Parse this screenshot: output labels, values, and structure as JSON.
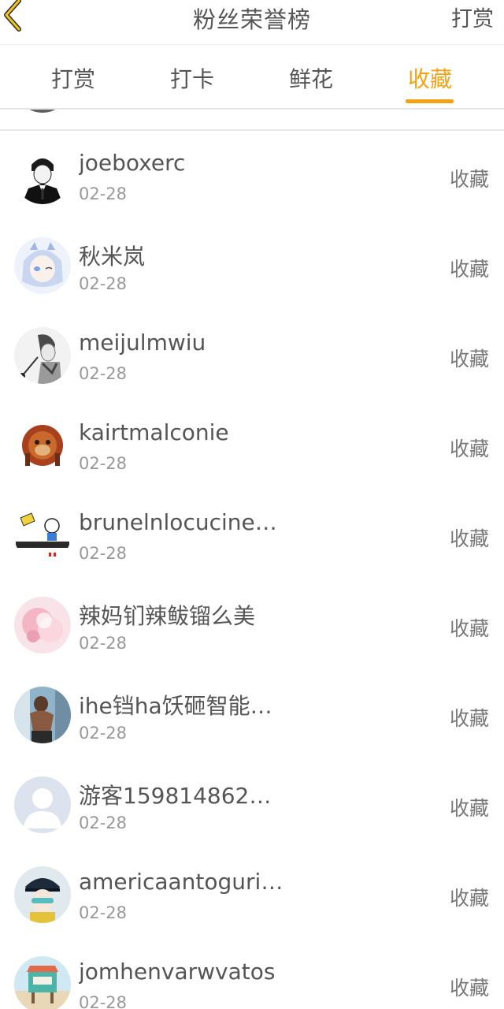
{
  "header": {
    "title": "粉丝荣誉榜",
    "right_label": "打赏"
  },
  "tabs": [
    {
      "label": "打赏",
      "active": false
    },
    {
      "label": "打卡",
      "active": false
    },
    {
      "label": "鲜花",
      "active": false
    },
    {
      "label": "收藏",
      "active": true
    }
  ],
  "colors": {
    "accent": "#f5a316",
    "text": "#555555",
    "subtext": "#999999"
  },
  "list": {
    "items": [
      {
        "name": "joeboxerc",
        "date": "02-28",
        "action": "收藏"
      },
      {
        "name": "秋米岚",
        "date": "02-28",
        "action": "收藏"
      },
      {
        "name": "meijulmwiu",
        "date": "02-28",
        "action": "收藏"
      },
      {
        "name": "kairtmalconie",
        "date": "02-28",
        "action": "收藏"
      },
      {
        "name": "brunelnlocucine…",
        "date": "02-28",
        "action": "收藏"
      },
      {
        "name": "辣妈钔辣鲅镏么美",
        "date": "02-28",
        "action": "收藏"
      },
      {
        "name": "ihe铛ha饫砸智能…",
        "date": "02-28",
        "action": "收藏"
      },
      {
        "name": "游客159814862…",
        "date": "02-28",
        "action": "收藏"
      },
      {
        "name": "americaantoguri…",
        "date": "02-28",
        "action": "收藏"
      },
      {
        "name": "jomhenvarwvatos",
        "date": "02-28",
        "action": "收藏"
      }
    ]
  }
}
